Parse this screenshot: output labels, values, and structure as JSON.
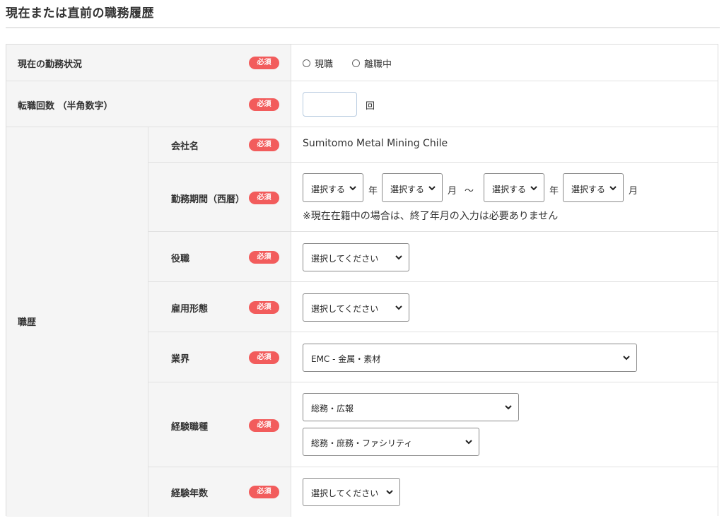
{
  "section_title": "現在または直前の職務履歴",
  "required_badge": "必須",
  "employment_status": {
    "label": "現在の勤務状況",
    "options": [
      "現職",
      "離職中"
    ]
  },
  "job_changes": {
    "label": "転職回数 （半角数字）",
    "value": "",
    "unit": "回"
  },
  "career": {
    "label": "職歴",
    "company": {
      "label": "会社名",
      "value": "Sumitomo Metal Mining Chile"
    },
    "period": {
      "label": "勤務期間（西暦）",
      "start_year": "選択する",
      "year_unit": "年",
      "start_month": "選択する",
      "month_unit": "月",
      "tilde": "〜",
      "end_year": "選択する",
      "end_month": "選択する",
      "note": "※現在在籍中の場合は、終了年月の入力は必要ありません"
    },
    "position": {
      "label": "役職",
      "selected": "選択してください"
    },
    "employment_type": {
      "label": "雇用形態",
      "selected": "選択してください"
    },
    "industry": {
      "label": "業界",
      "selected": "EMC - 金属・素材"
    },
    "job_type": {
      "label": "経験職種",
      "primary": "総務・広報",
      "secondary": "総務・庶務・ファシリティ"
    },
    "experience_years": {
      "label": "経験年数",
      "selected": "選択してください"
    }
  }
}
